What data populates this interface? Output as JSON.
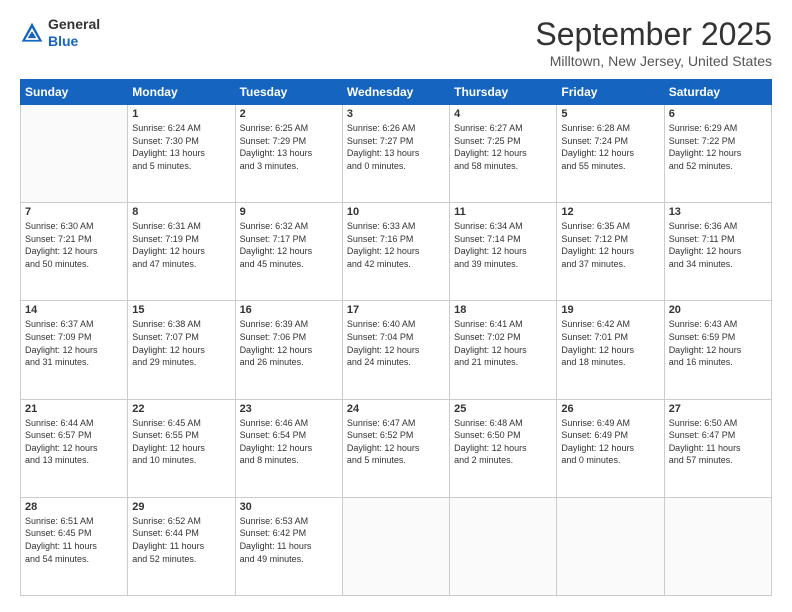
{
  "logo": {
    "general": "General",
    "blue": "Blue"
  },
  "header": {
    "month": "September 2025",
    "location": "Milltown, New Jersey, United States"
  },
  "weekdays": [
    "Sunday",
    "Monday",
    "Tuesday",
    "Wednesday",
    "Thursday",
    "Friday",
    "Saturday"
  ],
  "weeks": [
    [
      {
        "day": "",
        "info": ""
      },
      {
        "day": "1",
        "info": "Sunrise: 6:24 AM\nSunset: 7:30 PM\nDaylight: 13 hours\nand 5 minutes."
      },
      {
        "day": "2",
        "info": "Sunrise: 6:25 AM\nSunset: 7:29 PM\nDaylight: 13 hours\nand 3 minutes."
      },
      {
        "day": "3",
        "info": "Sunrise: 6:26 AM\nSunset: 7:27 PM\nDaylight: 13 hours\nand 0 minutes."
      },
      {
        "day": "4",
        "info": "Sunrise: 6:27 AM\nSunset: 7:25 PM\nDaylight: 12 hours\nand 58 minutes."
      },
      {
        "day": "5",
        "info": "Sunrise: 6:28 AM\nSunset: 7:24 PM\nDaylight: 12 hours\nand 55 minutes."
      },
      {
        "day": "6",
        "info": "Sunrise: 6:29 AM\nSunset: 7:22 PM\nDaylight: 12 hours\nand 52 minutes."
      }
    ],
    [
      {
        "day": "7",
        "info": "Sunrise: 6:30 AM\nSunset: 7:21 PM\nDaylight: 12 hours\nand 50 minutes."
      },
      {
        "day": "8",
        "info": "Sunrise: 6:31 AM\nSunset: 7:19 PM\nDaylight: 12 hours\nand 47 minutes."
      },
      {
        "day": "9",
        "info": "Sunrise: 6:32 AM\nSunset: 7:17 PM\nDaylight: 12 hours\nand 45 minutes."
      },
      {
        "day": "10",
        "info": "Sunrise: 6:33 AM\nSunset: 7:16 PM\nDaylight: 12 hours\nand 42 minutes."
      },
      {
        "day": "11",
        "info": "Sunrise: 6:34 AM\nSunset: 7:14 PM\nDaylight: 12 hours\nand 39 minutes."
      },
      {
        "day": "12",
        "info": "Sunrise: 6:35 AM\nSunset: 7:12 PM\nDaylight: 12 hours\nand 37 minutes."
      },
      {
        "day": "13",
        "info": "Sunrise: 6:36 AM\nSunset: 7:11 PM\nDaylight: 12 hours\nand 34 minutes."
      }
    ],
    [
      {
        "day": "14",
        "info": "Sunrise: 6:37 AM\nSunset: 7:09 PM\nDaylight: 12 hours\nand 31 minutes."
      },
      {
        "day": "15",
        "info": "Sunrise: 6:38 AM\nSunset: 7:07 PM\nDaylight: 12 hours\nand 29 minutes."
      },
      {
        "day": "16",
        "info": "Sunrise: 6:39 AM\nSunset: 7:06 PM\nDaylight: 12 hours\nand 26 minutes."
      },
      {
        "day": "17",
        "info": "Sunrise: 6:40 AM\nSunset: 7:04 PM\nDaylight: 12 hours\nand 24 minutes."
      },
      {
        "day": "18",
        "info": "Sunrise: 6:41 AM\nSunset: 7:02 PM\nDaylight: 12 hours\nand 21 minutes."
      },
      {
        "day": "19",
        "info": "Sunrise: 6:42 AM\nSunset: 7:01 PM\nDaylight: 12 hours\nand 18 minutes."
      },
      {
        "day": "20",
        "info": "Sunrise: 6:43 AM\nSunset: 6:59 PM\nDaylight: 12 hours\nand 16 minutes."
      }
    ],
    [
      {
        "day": "21",
        "info": "Sunrise: 6:44 AM\nSunset: 6:57 PM\nDaylight: 12 hours\nand 13 minutes."
      },
      {
        "day": "22",
        "info": "Sunrise: 6:45 AM\nSunset: 6:55 PM\nDaylight: 12 hours\nand 10 minutes."
      },
      {
        "day": "23",
        "info": "Sunrise: 6:46 AM\nSunset: 6:54 PM\nDaylight: 12 hours\nand 8 minutes."
      },
      {
        "day": "24",
        "info": "Sunrise: 6:47 AM\nSunset: 6:52 PM\nDaylight: 12 hours\nand 5 minutes."
      },
      {
        "day": "25",
        "info": "Sunrise: 6:48 AM\nSunset: 6:50 PM\nDaylight: 12 hours\nand 2 minutes."
      },
      {
        "day": "26",
        "info": "Sunrise: 6:49 AM\nSunset: 6:49 PM\nDaylight: 12 hours\nand 0 minutes."
      },
      {
        "day": "27",
        "info": "Sunrise: 6:50 AM\nSunset: 6:47 PM\nDaylight: 11 hours\nand 57 minutes."
      }
    ],
    [
      {
        "day": "28",
        "info": "Sunrise: 6:51 AM\nSunset: 6:45 PM\nDaylight: 11 hours\nand 54 minutes."
      },
      {
        "day": "29",
        "info": "Sunrise: 6:52 AM\nSunset: 6:44 PM\nDaylight: 11 hours\nand 52 minutes."
      },
      {
        "day": "30",
        "info": "Sunrise: 6:53 AM\nSunset: 6:42 PM\nDaylight: 11 hours\nand 49 minutes."
      },
      {
        "day": "",
        "info": ""
      },
      {
        "day": "",
        "info": ""
      },
      {
        "day": "",
        "info": ""
      },
      {
        "day": "",
        "info": ""
      }
    ]
  ]
}
